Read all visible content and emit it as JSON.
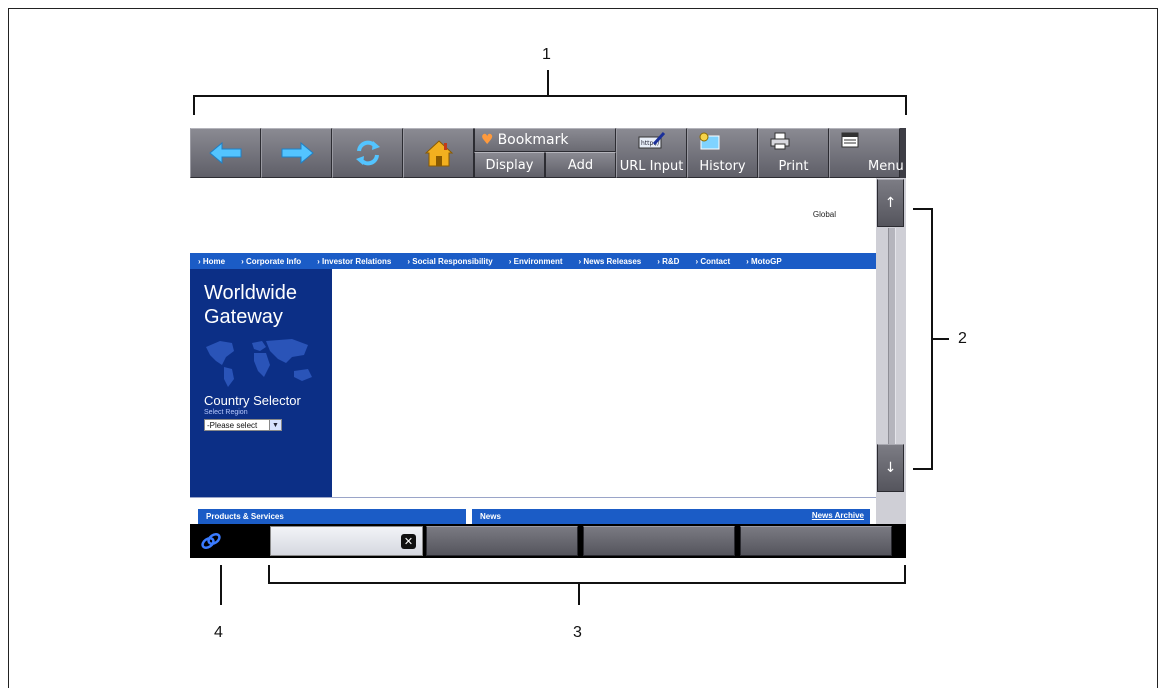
{
  "callouts": {
    "toolbar": "1",
    "scrollbar": "2",
    "tabs": "3",
    "link_icon": "4"
  },
  "toolbar": {
    "back_icon": "back-arrow-icon",
    "forward_icon": "forward-arrow-icon",
    "refresh_icon": "refresh-icon",
    "home_icon": "home-icon",
    "bookmark_label": "Bookmark",
    "bookmark_display": "Display",
    "bookmark_add": "Add",
    "url_input_label": "URL Input",
    "url_input_icon_text": "http://",
    "history_label": "History",
    "print_label": "Print",
    "menu_label": "Menu"
  },
  "web": {
    "global_label": "Global",
    "nav": [
      "› Home",
      "› Corporate Info",
      "› Investor Relations",
      "› Social Responsibility",
      "› Environment",
      "› News Releases",
      "› R&D",
      "› Contact",
      "› MotoGP"
    ],
    "gateway_title_line1": "Worldwide",
    "gateway_title_line2": "Gateway",
    "country_selector": "Country Selector",
    "select_region": "Select Region",
    "select_value": "-Please select",
    "products_label": "Products & Services",
    "news_label": "News",
    "news_archive": "News Archive"
  },
  "colors": {
    "nav_blue": "#1b5cc6",
    "panel_navy": "#0c2f86",
    "link_icon_blue": "#3a7bff"
  }
}
